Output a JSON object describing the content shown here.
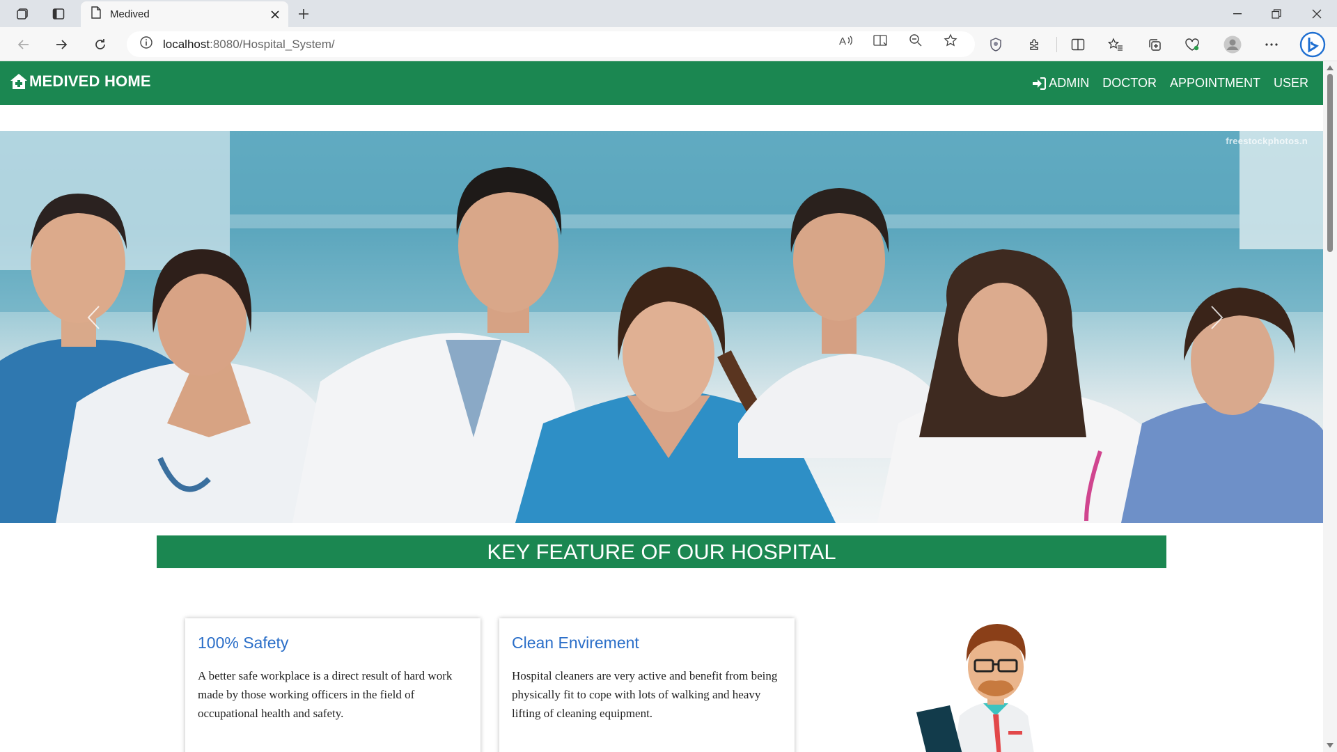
{
  "browser": {
    "tab_title": "Medived",
    "url_host": "localhost",
    "url_rest": ":8080/Hospital_System/"
  },
  "navbar": {
    "brand": "MEDIVED HOME",
    "links": [
      "ADMIN",
      "DOCTOR",
      "APPOINTMENT",
      "USER"
    ]
  },
  "hero": {
    "watermark": "freestockphotos.n"
  },
  "features": {
    "heading": "KEY FEATURE OF OUR HOSPITAL",
    "cards": [
      {
        "title": "100% Safety",
        "text": "A better safe workplace is a direct result of hard work made by those working officers in the field of occupational health and safety."
      },
      {
        "title": "Clean Envirement",
        "text": "Hospital cleaners are very active and benefit from being physically fit to cope with lots of walking and heavy lifting of cleaning equipment."
      }
    ]
  },
  "colors": {
    "brand_green": "#1b8751",
    "card_title_blue": "#2a6ec8"
  }
}
